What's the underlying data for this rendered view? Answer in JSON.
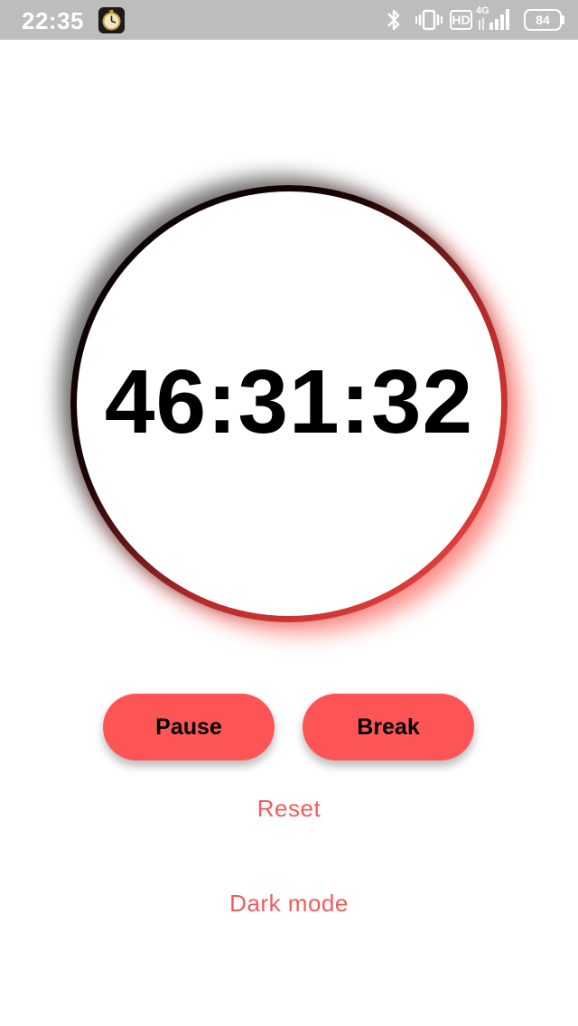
{
  "status_bar": {
    "time": "22:35",
    "network": "4G",
    "hd": "HD",
    "battery": "84",
    "icons": [
      "clock-app-icon",
      "bluetooth-icon",
      "vibrate-icon",
      "hd-icon",
      "signal-icon",
      "battery-icon"
    ]
  },
  "timer": {
    "display": "46:31:32"
  },
  "buttons": {
    "pause_label": "Pause",
    "break_label": "Break"
  },
  "links": {
    "reset_label": "Reset",
    "dark_mode_label": "Dark mode"
  },
  "colors": {
    "accent": "#fd5555",
    "link": "#f25b5b",
    "status_bar": "#bdbdbd"
  }
}
